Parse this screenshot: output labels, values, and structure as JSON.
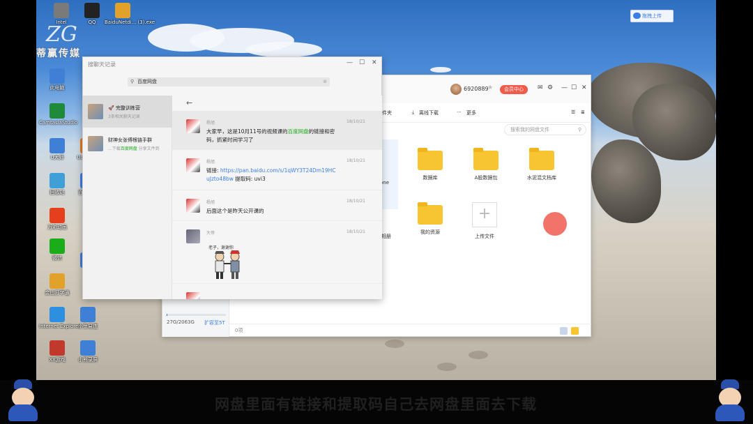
{
  "desktop": {
    "icons": [
      {
        "label": "Intel",
        "color": "#7a7a7a"
      },
      {
        "label": "QQ",
        "color": "#222"
      },
      {
        "label": "BaiduNetdi... (3).exe",
        "color": "#e2a12b"
      },
      {
        "label": "此电脑",
        "color": "#3f7fd6"
      },
      {
        "label": "CamtasiaStudio",
        "color": "#1e8a3a"
      },
      {
        "label": "U大师",
        "color": "#3f7fd6"
      },
      {
        "label": "UU加速器",
        "color": "#e57b1d"
      },
      {
        "label": "回收站",
        "color": "#3f9fd6"
      },
      {
        "label": "百度网盘",
        "color": "#3b7fe6"
      },
      {
        "label": "万彩动画",
        "color": "#e5401d"
      },
      {
        "label": "微信",
        "color": "#1aad19"
      },
      {
        "label": "迅雷",
        "color": "#3f7fd6"
      },
      {
        "label": "金山打字通",
        "color": "#e2a12b"
      },
      {
        "label": "Internet Explorer",
        "color": "#2d8fe0"
      },
      {
        "label": "小鱼易连",
        "color": "#3f7fd6"
      },
      {
        "label": "XX游戏",
        "color": "#c0392b"
      },
      {
        "label": "小熊录屏",
        "color": "#3f7fd6"
      }
    ]
  },
  "watermark": {
    "letters": "ZG",
    "name": "蒂赢传媒"
  },
  "baidu_float": {
    "label": "拖拽上传"
  },
  "netdisk": {
    "user": "6920889",
    "vip_label": "会员中心",
    "toolbar": {
      "share": "文件夹",
      "offline": "离线下载",
      "more": "更多"
    },
    "search_placeholder": "搜索我的网盘文件",
    "folders": [
      {
        "label": "数据库"
      },
      {
        "label": "A股数据包"
      },
      {
        "label": "水泥混文档库"
      },
      {
        "label": "我的资源"
      }
    ],
    "partial_labels": {
      "one": "one",
      "album": "相册"
    },
    "upload_label": "上传文件",
    "storage": "27G/2063G",
    "storage_fraction": 0.013,
    "expand_label": "扩容至5T",
    "status": "0项"
  },
  "chat": {
    "title": "搜聊天记录",
    "search_value": "百度网盘",
    "conversations": [
      {
        "name": "🚀 完整训练营",
        "snippet": "3条相关聊天记录"
      },
      {
        "name": "财神女张傅根链手群",
        "snippet_pre": "...下载",
        "snippet_hl": "百度网盘",
        "snippet_post": " 分享文件到"
      }
    ],
    "messages": [
      {
        "sender": "杨旭",
        "date": "18/10/21",
        "pre": "大家早，这是10月11号的视频课的",
        "hl": "百度网盘",
        "post": "的链接和密码，抓紧时间学习了"
      },
      {
        "sender": "杨旭",
        "date": "18/10/21",
        "link_label": "链接: ",
        "link": "https://pan.baidu.com/s/1qWY3T24Dm19HCuJzto48bw",
        "code": " 提取码: uvi3"
      },
      {
        "sender": "杨旭",
        "date": "18/10/21",
        "text": "后面这个是昨天公开课的"
      },
      {
        "sender": "大帝",
        "date": "18/10/21",
        "sticker_caption": "老子，谢谢你"
      }
    ]
  },
  "subtitle": "网盘里面有链接和提取码自己去网盘里面去下载"
}
